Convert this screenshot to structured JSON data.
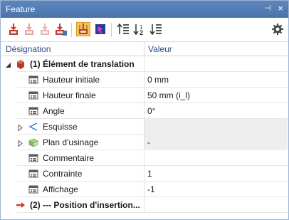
{
  "panel": {
    "title": "Feature",
    "pin_glyph": "⊣",
    "close_glyph": "×"
  },
  "toolbar": {
    "tools": [
      {
        "name": "add-feature-icon",
        "active": false
      },
      {
        "name": "insert-feature-icon",
        "active": false
      },
      {
        "name": "insert-feature-disabled-icon",
        "active": false
      },
      {
        "name": "delete-feature-icon",
        "active": false
      },
      {
        "name": "feature-list-icon",
        "active": true
      },
      {
        "name": "pointer-select-icon",
        "active": false
      },
      {
        "name": "move-up-icon",
        "active": false
      },
      {
        "name": "move-down-icon",
        "active": false
      },
      {
        "name": "list-options-icon",
        "active": false
      }
    ],
    "settings_icon": "gear-icon"
  },
  "grid": {
    "col_name": "Désignation",
    "col_value": "Valeur",
    "rows": [
      {
        "label": "(1) Élément de translation",
        "value": "",
        "bold": true,
        "icon": "translation-element-icon",
        "expander": "expanded",
        "indent": 0,
        "grey": false
      },
      {
        "label": "Hauteur initiale",
        "value": "0 mm",
        "bold": false,
        "icon": "parameter-icon",
        "expander": "",
        "indent": 1,
        "grey": false
      },
      {
        "label": "Hauteur finale",
        "value": "50 mm (i_l)",
        "bold": false,
        "icon": "parameter-icon",
        "expander": "",
        "indent": 1,
        "grey": false
      },
      {
        "label": "Angle",
        "value": "0°",
        "bold": false,
        "icon": "parameter-icon",
        "expander": "",
        "indent": 1,
        "grey": false
      },
      {
        "label": "Esquisse",
        "value": "",
        "bold": false,
        "icon": "sketch-icon",
        "expander": "collapsed",
        "indent": 1,
        "grey": true
      },
      {
        "label": "Plan d'usinage",
        "value": "-",
        "bold": false,
        "icon": "machining-plane-icon",
        "expander": "collapsed",
        "indent": 1,
        "grey": true
      },
      {
        "label": "Commentaire",
        "value": "",
        "bold": false,
        "icon": "parameter-icon",
        "expander": "",
        "indent": 1,
        "grey": false
      },
      {
        "label": "Contrainte",
        "value": "1",
        "bold": false,
        "icon": "parameter-icon",
        "expander": "",
        "indent": 1,
        "grey": false
      },
      {
        "label": "Affichage",
        "value": "-1",
        "bold": false,
        "icon": "parameter-icon",
        "expander": "",
        "indent": 1,
        "grey": false
      },
      {
        "label": "(2) --- Position  d'insertion...",
        "value": "",
        "bold": true,
        "icon": "insertion-arrow-icon",
        "expander": "",
        "indent": 0,
        "grey": false
      }
    ]
  },
  "colors": {
    "title_bar": "#4f79b0",
    "active_tool": "#f6c35b",
    "header_text": "#2a4d8a",
    "insertion_arrow": "#e03a2a"
  }
}
